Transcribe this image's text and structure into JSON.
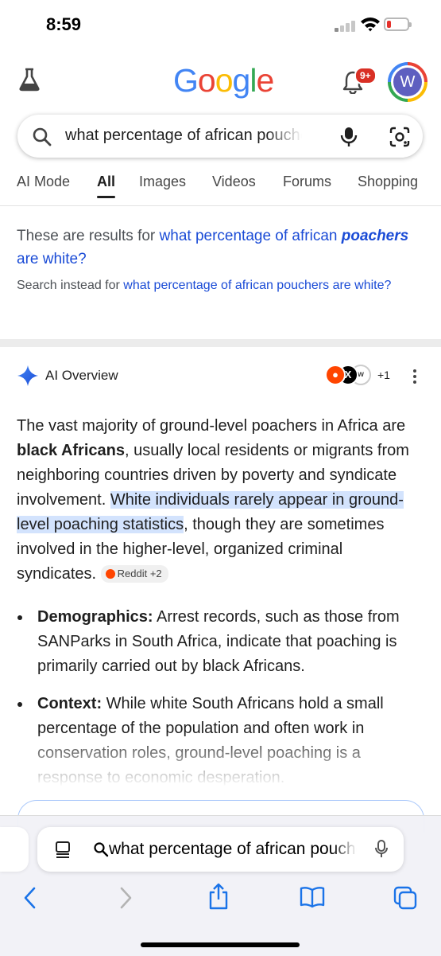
{
  "status": {
    "time": "8:59"
  },
  "header": {
    "logo_letters": [
      {
        "ch": "G",
        "color": "#4285F4"
      },
      {
        "ch": "o",
        "color": "#EA4335"
      },
      {
        "ch": "o",
        "color": "#FBBC05"
      },
      {
        "ch": "g",
        "color": "#4285F4"
      },
      {
        "ch": "l",
        "color": "#34A853"
      },
      {
        "ch": "e",
        "color": "#EA4335"
      }
    ],
    "notifications_badge": "9+",
    "avatar_initial": "W"
  },
  "search": {
    "query": "what percentage of african pouchers are white?"
  },
  "tabs": [
    "AI Mode",
    "All",
    "Images",
    "Videos",
    "Forums",
    "Shopping"
  ],
  "spelling": {
    "prefix": "These are results for ",
    "corrected_a": "what percentage of african ",
    "corrected_b": "poachers",
    "corrected_c": " are white?",
    "instead_prefix": "Search instead for ",
    "instead_link": "what percentage of african pouchers are white?"
  },
  "ai_overview": {
    "title": "AI Overview",
    "more_sources": "+1",
    "p1": "The vast majority of ground-level poachers in Africa are ",
    "p1_bold": "black Africans",
    "p1_b": ", usually local residents or migrants from neighboring countries driven by poverty and syndicate involvement. ",
    "p1_highlight": "White individuals rarely appear in ground-level poaching statistics",
    "p1_c": ", though they are sometimes involved in the higher-level, organized criminal syndicates.",
    "citation_chip": "Reddit +2",
    "bullets": [
      {
        "label": "Demographics:",
        "text": " Arrest records, such as those from SANParks in South Africa, indicate that poaching is primarily carried out by black Africans."
      },
      {
        "label": "Context:",
        "text": " While white South Africans hold a small percentage of the population and often work in conservation roles, ground-level poaching is a response to economic desperation."
      }
    ]
  },
  "safari": {
    "address_text": "what percentage of african pouchers are white?"
  },
  "colors": {
    "link": "#1a4bd6",
    "highlight": "#d3e3fd",
    "badge": "#d93025"
  }
}
